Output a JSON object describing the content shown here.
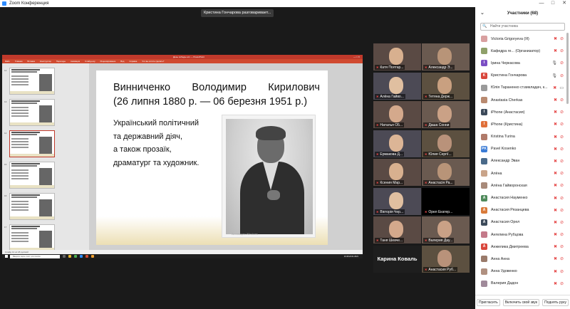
{
  "window": {
    "title": "Zoom Конференция"
  },
  "speaking_banner": "Кристина Гончарова разговаривает...",
  "powerpoint": {
    "title": "День победы.ocx — PowerPoint",
    "menu": [
      "Файл",
      "Главная",
      "Вставка",
      "Конструктор",
      "Переходы",
      "Анимация",
      "Слайд-шоу",
      "Рецензирование",
      "Вид",
      "Справка",
      "Что вы хотите сделать?"
    ],
    "slide_numbers": [
      "12",
      "13",
      "14",
      "15",
      "16",
      "17"
    ],
    "status": "Слайд 14 из 18   русский",
    "taskbar_search": "Введите здесь текст для поиска",
    "clock": "13:48  22.01.2021",
    "slide": {
      "title_line1_words": [
        "Винниченко",
        "Володимир",
        "Кирилович"
      ],
      "title_line2": "(26 липня 1880 р. — 06 березня 1951 р.)",
      "body_lines": [
        "Український політичний",
        "та державний діяч,",
        "а також прозаїк,",
        "драматург та художник."
      ],
      "watermark": "Активация Windows"
    }
  },
  "video_tiles": [
    {
      "name": "Катя Полтар...",
      "kind": "video"
    },
    {
      "name": "Александр Э...",
      "kind": "video"
    },
    {
      "name": "Алёна Гайво...",
      "kind": "video"
    },
    {
      "name": "Тетяна Держ...",
      "kind": "video"
    },
    {
      "name": "Наталья О5...",
      "kind": "video"
    },
    {
      "name": "Даша Сонни",
      "kind": "video"
    },
    {
      "name": "Ермакова Д...",
      "kind": "video"
    },
    {
      "name": "Юлия Сергії...",
      "kind": "video"
    },
    {
      "name": "Ксения Мар...",
      "kind": "video"
    },
    {
      "name": "Анастасія Ра...",
      "kind": "video"
    },
    {
      "name": "Вікторія Чер...",
      "kind": "video"
    },
    {
      "name": "Орел Екатер...",
      "kind": "black"
    },
    {
      "name": "Таня Шевче...",
      "kind": "video"
    },
    {
      "name": "Валерия Дау...",
      "kind": "video"
    },
    {
      "name": "Карина Коваль",
      "kind": "text"
    },
    {
      "name": "Анастасия Руб...",
      "kind": "video"
    }
  ],
  "participants_panel": {
    "header": "Участники (68)",
    "search_placeholder": "Найти участника",
    "participants": [
      {
        "name": "Victoria Grigoryeva (Я)",
        "initial": "",
        "color": "#d9a0a0",
        "icons": [
          "mic-off",
          "video-off"
        ]
      },
      {
        "name": "Кафедра ге... (Организатор)",
        "initial": "",
        "color": "#8fa06a",
        "icons": [
          "mic-off",
          "video-off"
        ]
      },
      {
        "name": "Ірина Черкасова",
        "initial": "I",
        "color": "#7b4fc4",
        "icons": [
          "mic",
          "video-off"
        ]
      },
      {
        "name": "Кристина Гончарова",
        "initial": "K",
        "color": "#d9463b",
        "icons": [
          "mic",
          "video-off"
        ]
      },
      {
        "name": "Юлія Тараненко ст.викладач, к...",
        "initial": "",
        "color": "#9a9a9a",
        "icons": [
          "mic-off",
          "video"
        ]
      },
      {
        "name": "Anastasia Cherkas",
        "initial": "",
        "color": "#b98a70",
        "icons": [
          "mic-off",
          "video-off"
        ]
      },
      {
        "name": "iPhone (Анастасия)",
        "initial": "I",
        "color": "#3c4a5a",
        "icons": [
          "mic-off",
          "video-off"
        ]
      },
      {
        "name": "iPhone (Кристина)",
        "initial": "I",
        "color": "#e0703a",
        "icons": [
          "mic-off",
          "video-off"
        ]
      },
      {
        "name": "Kristina Turina",
        "initial": "",
        "color": "#b07a6a",
        "icons": [
          "mic-off",
          "video-off"
        ]
      },
      {
        "name": "Pavel Kosenko",
        "initial": "PK",
        "color": "#3a7bd5",
        "icons": [
          "mic-off",
          "video-off"
        ]
      },
      {
        "name": "Александр Эван",
        "initial": "",
        "color": "#4a6a8a",
        "icons": [
          "mic-off",
          "video-off"
        ]
      },
      {
        "name": "Алёна",
        "initial": "",
        "color": "#c9a48a",
        "icons": [
          "mic-off",
          "video-off"
        ]
      },
      {
        "name": "Алёна Гайворонская",
        "initial": "",
        "color": "#a88a7a",
        "icons": [
          "mic-off",
          "video-off"
        ]
      },
      {
        "name": "Анастасия Науменко",
        "initial": "A",
        "color": "#4f8a5b",
        "icons": [
          "mic-off",
          "video-off"
        ]
      },
      {
        "name": "Анастасия Рязанцева",
        "initial": "A",
        "color": "#d97a3a",
        "icons": [
          "mic-off",
          "video-off"
        ]
      },
      {
        "name": "Анастасия Орел",
        "initial": "A",
        "color": "#3c4a5a",
        "icons": [
          "mic-off",
          "video-off"
        ]
      },
      {
        "name": "Ангелина Рубцова",
        "initial": "",
        "color": "#c47a8a",
        "icons": [
          "mic-off",
          "video-off"
        ]
      },
      {
        "name": "Анжелика Дмитреева",
        "initial": "A",
        "color": "#d9463b",
        "icons": [
          "mic-off",
          "video-off"
        ]
      },
      {
        "name": "Анна Анна",
        "initial": "",
        "color": "#9a7a6a",
        "icons": [
          "mic-off",
          "video-off"
        ]
      },
      {
        "name": "Анна Удовенко",
        "initial": "",
        "color": "#b09080",
        "icons": [
          "mic-off",
          "video-off"
        ]
      },
      {
        "name": "Валерия Дадон",
        "initial": "",
        "color": "#a08a9a",
        "icons": [
          "mic-off",
          "video-off"
        ]
      }
    ],
    "footer": [
      "Пригласить",
      "Включить свой звук",
      "Поднять руку"
    ]
  }
}
